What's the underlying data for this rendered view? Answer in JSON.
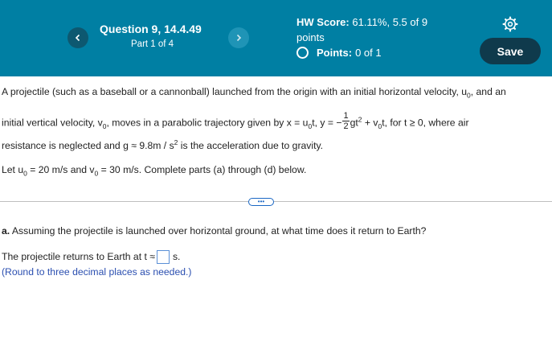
{
  "header": {
    "question_title": "Question 9, 14.4.49",
    "question_part": "Part 1 of 4",
    "hw_score_label": "HW Score:",
    "hw_score_value": "61.11%, 5.5 of 9",
    "hw_score_unit": "points",
    "points_label": "Points:",
    "points_value": "0 of 1",
    "save_label": "Save",
    "prev_icon": "chevron-left-icon",
    "next_icon": "chevron-right-icon",
    "settings_icon": "gear-icon"
  },
  "problem": {
    "line1": "A projectile (such as a baseball or a cannonball) launched from the origin with an initial horizontal velocity, u",
    "line1_sub": "0",
    "line1_end": ", and an",
    "line2_a": "initial vertical velocity, v",
    "line2_sub": "0",
    "line2_b": ", moves in a parabolic trajectory given by x = u",
    "line2_c": "t, y = −",
    "frac_num": "1",
    "frac_den": "2",
    "line2_d": "gt",
    "line2_exp": "2",
    "line2_e": " + v",
    "line2_f": "t, for t ≥ 0, where air",
    "line3_a": "resistance is neglected and g ≈ 9.8m / s",
    "line3_b": " is the acceleration due to gravity.",
    "line4_a": "Let u",
    "line4_b": " = 20 m/s and v",
    "line4_c": " = 30 m/s. Complete parts (a) through (d) below."
  },
  "expand_label": "•••",
  "part_a": {
    "label": "a.",
    "question": " Assuming the projectile is launched over horizontal ground, at what time does it return to Earth?",
    "answer_prefix": "The projectile returns to Earth at t ≈",
    "answer_value": "",
    "answer_unit": "s.",
    "hint": "(Round to three decimal places as needed.)"
  },
  "colors": {
    "header_bg": "#007fa3",
    "save_bg": "#0f3a4c",
    "hint_text": "#2b4fb0",
    "answer_border": "#5a8fd6"
  }
}
